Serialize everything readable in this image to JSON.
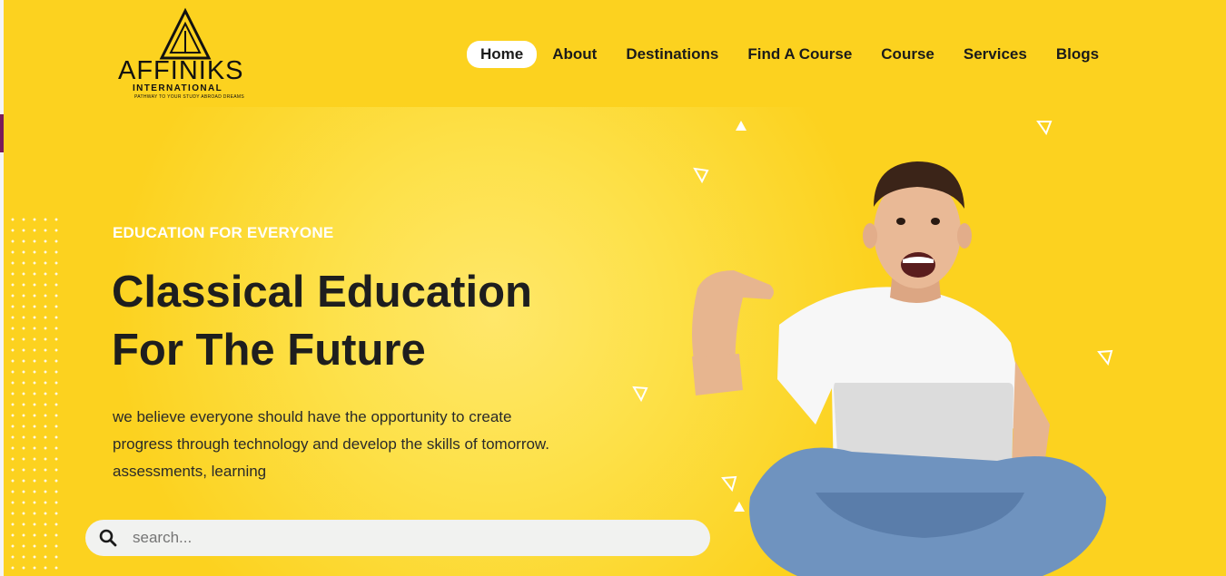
{
  "brand": {
    "logo_word": "AFFINIKS",
    "logo_sub": "INTERNATIONAL",
    "logo_tagline": "PATHWAY TO YOUR STUDY ABROAD DREAMS"
  },
  "nav": {
    "items": [
      {
        "label": "Home",
        "active": true
      },
      {
        "label": "About"
      },
      {
        "label": "Destinations"
      },
      {
        "label": "Find A Course"
      },
      {
        "label": "Course"
      },
      {
        "label": "Services"
      },
      {
        "label": "Blogs"
      }
    ]
  },
  "hero": {
    "eyebrow": "EDUCATION FOR EVERYONE",
    "headline_line1": "Classical Education",
    "headline_line2": "For The Future",
    "desc_line1": "we believe everyone should have the opportunity to create",
    "desc_line2": "progress through technology and develop the skills of tomorrow.",
    "desc_line3": "assessments, learning"
  },
  "search": {
    "placeholder": "search...",
    "value": "",
    "icon": "search-icon"
  },
  "colors": {
    "background": "#fcd21f",
    "headline": "#1e1e1e",
    "eyebrow": "#ffffff",
    "accent_strip": "#7a1b5a"
  }
}
